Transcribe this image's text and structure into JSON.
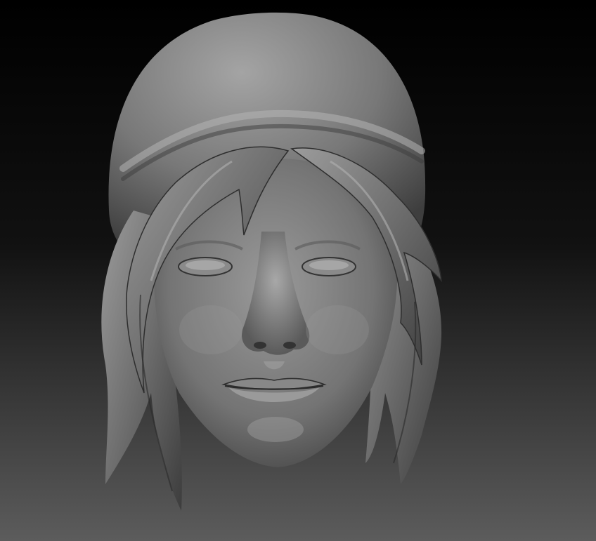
{
  "viewport": {
    "background_top": "#000000",
    "background_bottom": "#5a5a5a",
    "material_light": "#a8a8a8",
    "material_mid": "#7a7a7a",
    "material_dark": "#3a3a3a",
    "model_subject": "head-sculpt-icon"
  }
}
